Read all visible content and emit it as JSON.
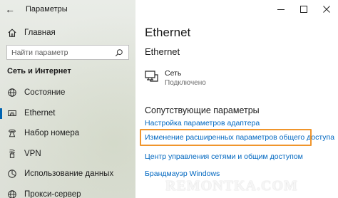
{
  "window": {
    "title": "Параметры",
    "controls": {
      "minimize": "—",
      "maximize": "☐",
      "close": "✕"
    }
  },
  "sidebar": {
    "home_label": "Главная",
    "search_placeholder": "Найти параметр",
    "section_title": "Сеть и Интернет",
    "items": [
      {
        "label": "Состояние",
        "icon": "globe-icon"
      },
      {
        "label": "Ethernet",
        "icon": "ethernet-icon",
        "active": true
      },
      {
        "label": "Набор номера",
        "icon": "phone-icon"
      },
      {
        "label": "VPN",
        "icon": "vpn-icon"
      },
      {
        "label": "Использование данных",
        "icon": "data-usage-icon"
      },
      {
        "label": "Прокси-сервер",
        "icon": "globe-icon"
      }
    ]
  },
  "main": {
    "page_title": "Ethernet",
    "subtitle": "Ethernet",
    "network": {
      "name": "Сеть",
      "status": "Подключено",
      "icon": "network-computer-icon"
    },
    "related_title": "Сопутствующие параметры",
    "links": [
      "Настройка параметров адаптера",
      "Изменение расширенных параметров общего доступа",
      "Центр управления сетями и общим доступом",
      "Брандмауэр Windows"
    ]
  },
  "highlight_color": "#f0952b",
  "accent_color": "#0063b1",
  "link_color": "#0067c0",
  "watermark": "REMONTKA.COM"
}
